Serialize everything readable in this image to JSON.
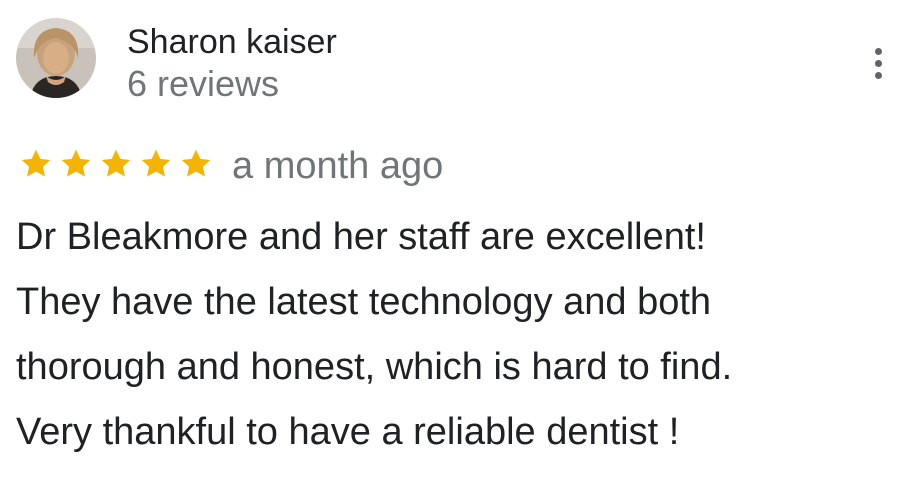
{
  "reviewer": {
    "name": "Sharon kaiser",
    "review_count": "6 reviews",
    "avatar_icon": "user-avatar-photo"
  },
  "menu": {
    "icon": "more-vert-icon"
  },
  "rating": {
    "stars": 5,
    "max_stars": 5,
    "star_color": "#f4b400",
    "time_ago": "a month ago"
  },
  "review": {
    "lines": [
      "Dr Bleakmore and her staff are excellent!",
      "They have the latest technology and both",
      "thorough and honest, which is hard to find.",
      "Very thankful to have a reliable dentist !"
    ]
  }
}
